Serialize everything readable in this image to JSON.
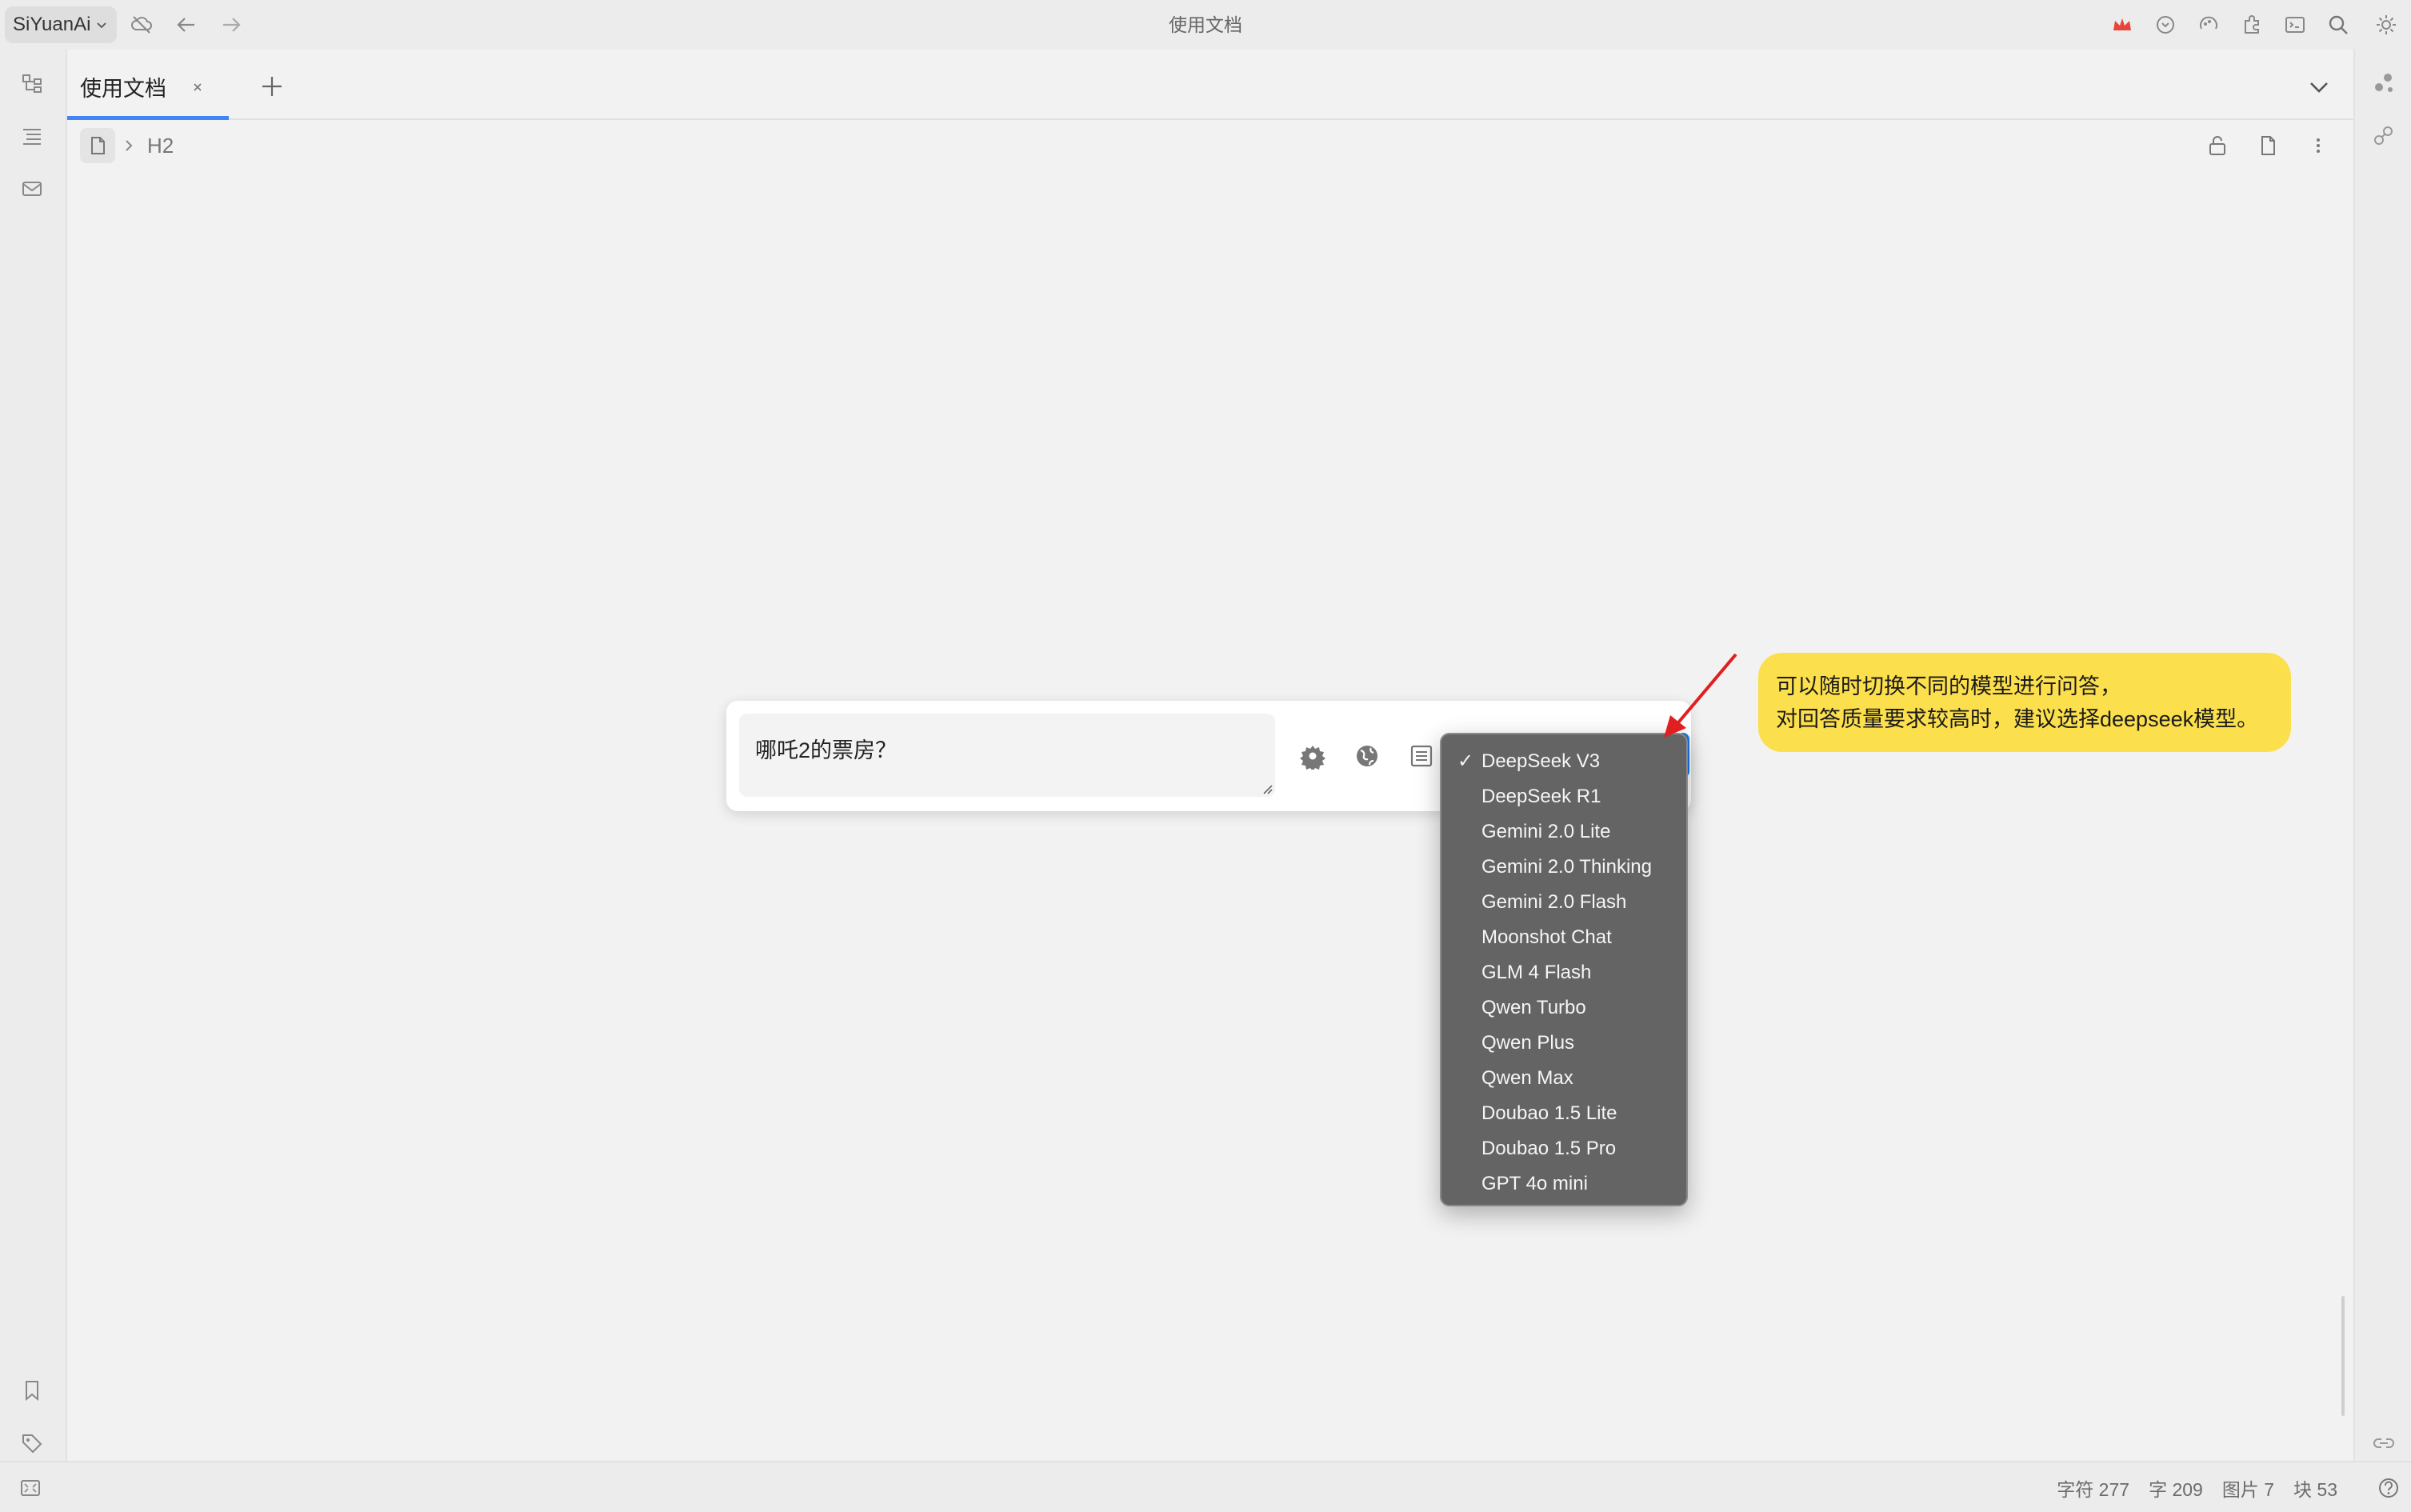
{
  "window": {
    "title": "使用文档",
    "workspace": "SiYuanAi"
  },
  "tabs": [
    {
      "label": "使用文档",
      "active": true
    }
  ],
  "breadcrumb": {
    "heading": "H2"
  },
  "chat": {
    "input_value": "哪吒2的票房？"
  },
  "models": {
    "selected": "DeepSeek V3",
    "check_mark": "✓",
    "items": [
      "DeepSeek V3",
      "DeepSeek R1",
      "Gemini 2.0 Lite",
      "Gemini 2.0 Thinking",
      "Gemini 2.0 Flash",
      "Moonshot Chat",
      "GLM 4 Flash",
      "Qwen Turbo",
      "Qwen Plus",
      "Qwen Max",
      "Doubao 1.5 Lite",
      "Doubao 1.5 Pro",
      "GPT 4o mini"
    ]
  },
  "callout": {
    "line1": "可以随时切换不同的模型进行问答，",
    "line2": "对回答质量要求较高时，建议选择deepseek模型。"
  },
  "status": {
    "chars": "字符 277",
    "words": "字 209",
    "images": "图片 7",
    "blocks": "块 53"
  },
  "colors": {
    "accent": "#4285f4",
    "callout": "#fcdf4c",
    "menu_bg": "#646464",
    "arrow": "#e02020",
    "crown": "#e8443a"
  }
}
